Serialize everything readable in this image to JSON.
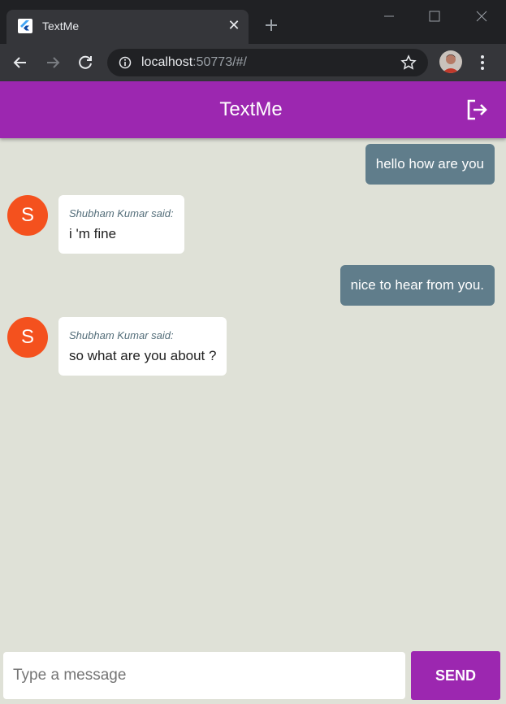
{
  "browser": {
    "tab_title": "TextMe",
    "tab_close": "✕",
    "url_host": "localhost",
    "url_rest": ":50773/#/",
    "favicon": "flutter-icon"
  },
  "app": {
    "title": "TextMe",
    "logout_icon": "logout-icon",
    "accent_color": "#9c27b0"
  },
  "messages": [
    {
      "type": "sent",
      "text": "hello how are you"
    },
    {
      "type": "received",
      "avatar": "S",
      "sender": "Shubham Kumar said:",
      "text": "i 'm fine"
    },
    {
      "type": "sent",
      "text": "nice to hear from you."
    },
    {
      "type": "received",
      "avatar": "S",
      "sender": "Shubham Kumar said:",
      "text": "so what are you about ?"
    }
  ],
  "composer": {
    "placeholder": "Type a message",
    "value": "",
    "send_label": "SEND"
  }
}
